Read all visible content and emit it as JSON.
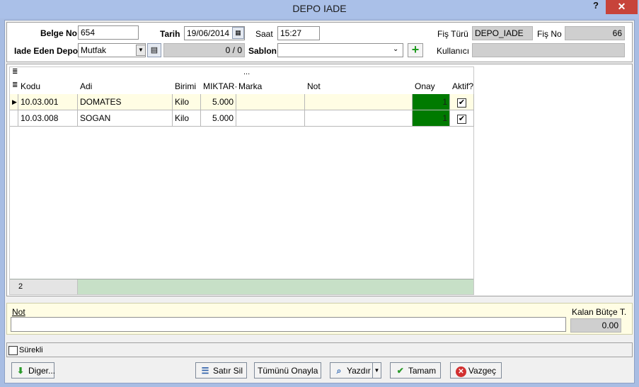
{
  "window": {
    "title": "DEPO IADE",
    "help": "?",
    "close": "✕"
  },
  "header": {
    "belge_no": {
      "label": "Belge No",
      "value": "654"
    },
    "tarih": {
      "label": "Tarih",
      "value": "19/06/2014"
    },
    "saat": {
      "label": "Saat",
      "value": "15:27"
    },
    "fis_turu": {
      "label": "Fiş Türü",
      "value": "DEPO_IADE"
    },
    "fis_no": {
      "label": "Fiş No",
      "value": "66"
    },
    "iade_eden_depo": {
      "label": "Iade Eden Depo",
      "value": "Mutfak",
      "counter": "0 / 0"
    },
    "sablon": {
      "label": "Sablon",
      "value": ""
    },
    "kullanici": {
      "label": "Kullanıcı",
      "value": ""
    }
  },
  "grid": {
    "group_bar": "...",
    "columns": [
      "Kodu",
      "Adi",
      "Birimi",
      "MIKTAR·",
      "Marka",
      "Not",
      "Onay",
      "Aktif?"
    ],
    "rows": [
      {
        "kodu": "10.03.001",
        "adi": "DOMATES",
        "birimi": "Kilo",
        "miktar": "5.000",
        "marka": "",
        "not": "",
        "onay": "1",
        "aktif": "✔"
      },
      {
        "kodu": "10.03.008",
        "adi": "SOGAN",
        "birimi": "Kilo",
        "miktar": "5.000",
        "marka": "",
        "not": "",
        "onay": "1",
        "aktif": "✔"
      }
    ],
    "record_count": "2"
  },
  "note": {
    "label": "Not",
    "value": ""
  },
  "budget": {
    "label": "Kalan Bütçe T.",
    "value": "0.00"
  },
  "surekli": {
    "label": "Sürekli"
  },
  "buttons": {
    "diger": "Diger...",
    "satir_sil": "Satır Sil",
    "tumunu_onayla": "Tümünü Onayla",
    "yazdir": "Yazdır",
    "tamam": "Tamam",
    "vazgec": "Vazgeç"
  },
  "colors": {
    "accent_onay": "#007a00",
    "title_bar": "#aac0e8",
    "close": "#c7433a"
  }
}
